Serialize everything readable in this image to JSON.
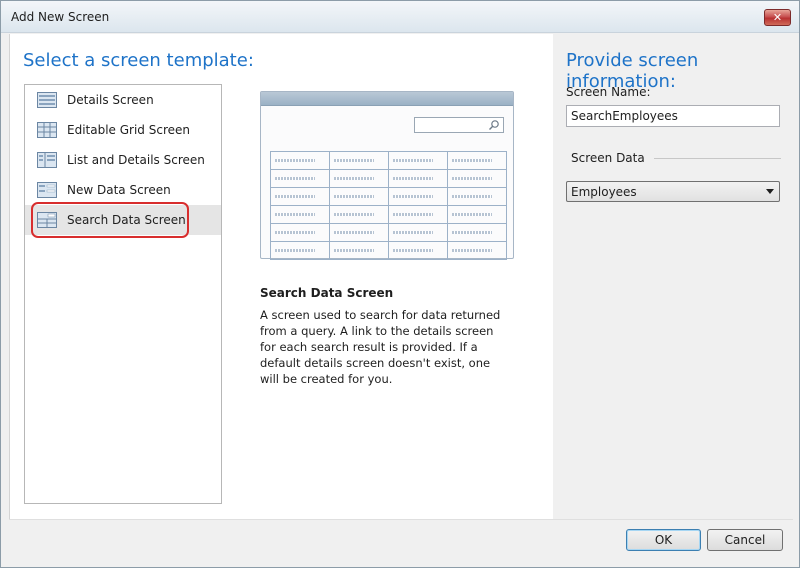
{
  "window": {
    "title": "Add New Screen"
  },
  "left": {
    "heading": "Select a screen template:",
    "templates": [
      {
        "label": "Details Screen",
        "icon": "details-screen-icon"
      },
      {
        "label": "Editable Grid Screen",
        "icon": "editable-grid-icon"
      },
      {
        "label": "List and Details Screen",
        "icon": "list-details-icon"
      },
      {
        "label": "New Data Screen",
        "icon": "new-data-icon"
      },
      {
        "label": "Search Data Screen",
        "icon": "search-data-icon",
        "selected": true
      }
    ]
  },
  "description": {
    "title": "Search Data Screen",
    "text": "A screen used to search for data returned from a query.  A link to the details screen for each search result is provided.  If a default details screen doesn't exist, one will be created for you."
  },
  "right": {
    "heading": "Provide screen information:",
    "screen_name_label": "Screen Name:",
    "screen_name_value": "SearchEmployees",
    "screen_data_label": "Screen Data",
    "screen_data_value": "Employees"
  },
  "footer": {
    "ok_label": "OK",
    "cancel_label": "Cancel"
  },
  "colors": {
    "accent": "#1e73c8",
    "selection_ring": "#d82e2e"
  }
}
